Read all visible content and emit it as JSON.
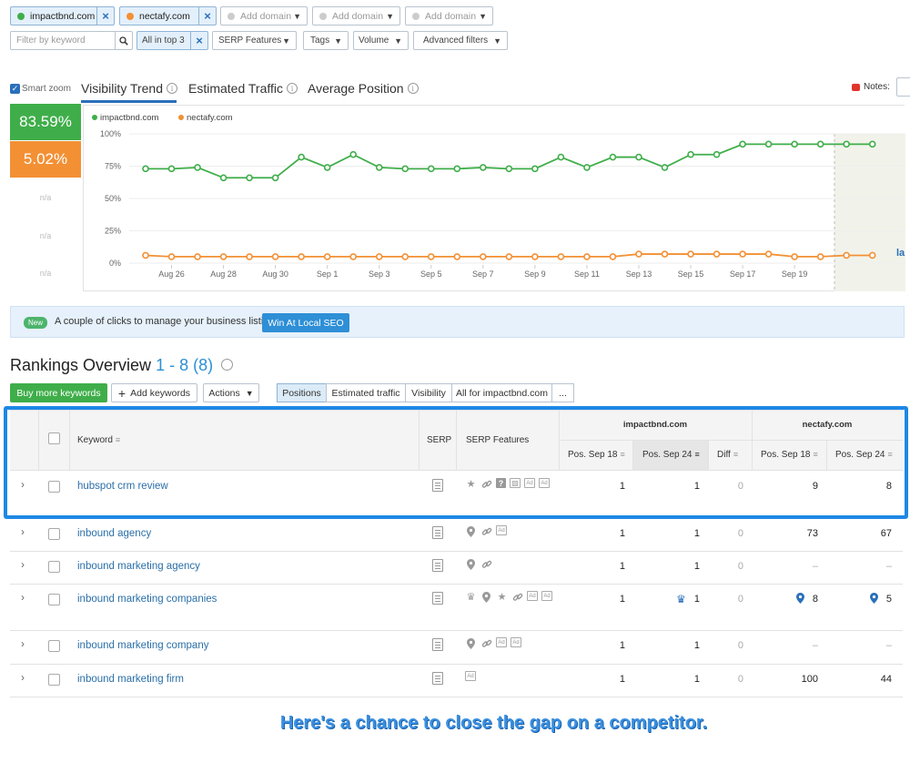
{
  "domains": [
    {
      "name": "impactbnd.com",
      "color": "#3fae4a"
    },
    {
      "name": "nectafy.com",
      "color": "#f39034"
    }
  ],
  "add_domain_placeholders": [
    "Add domain",
    "Add domain",
    "Add domain"
  ],
  "filters": {
    "keyword_placeholder": "Filter by keyword",
    "all_in_top": "All in top 3",
    "serp_features": "SERP Features",
    "tags": "Tags",
    "volume": "Volume",
    "advanced": "Advanced filters"
  },
  "smart_zoom": "Smart zoom",
  "tabs": [
    "Visibility Trend",
    "Estimated Traffic",
    "Average Position"
  ],
  "notes_label": "Notes:",
  "scores": [
    {
      "value": "83.59%",
      "color": "#3fae4a"
    },
    {
      "value": "5.02%",
      "color": "#f39034"
    },
    {
      "value": "n/a"
    },
    {
      "value": "n/a"
    },
    {
      "value": "n/a"
    }
  ],
  "chart_data": {
    "type": "line",
    "legend": [
      "impactbnd.com",
      "nectafy.com"
    ],
    "y_ticks": [
      "100%",
      "75%",
      "50%",
      "25%",
      "0%"
    ],
    "ylim": [
      0,
      100
    ],
    "x_labels": [
      "Aug 26",
      "Aug 28",
      "Aug 30",
      "Sep 1",
      "Sep 3",
      "Sep 5",
      "Sep 7",
      "Sep 9",
      "Sep 11",
      "Sep 13",
      "Sep 15",
      "Sep 17",
      "Sep 19"
    ],
    "series": [
      {
        "name": "impactbnd.com",
        "color": "#3fae4a",
        "values": [
          73,
          73,
          74,
          66,
          66,
          66,
          82,
          74,
          84,
          74,
          73,
          73,
          73,
          74,
          73,
          73,
          82,
          74,
          82,
          82,
          74,
          84,
          84,
          92,
          92,
          92,
          92,
          92,
          92
        ]
      },
      {
        "name": "nectafy.com",
        "color": "#f39034",
        "values": [
          6,
          5,
          5,
          5,
          5,
          5,
          5,
          5,
          5,
          5,
          5,
          5,
          5,
          5,
          5,
          5,
          5,
          5,
          5,
          7,
          7,
          7,
          7,
          7,
          7,
          5,
          5,
          6,
          6
        ]
      }
    ],
    "partial_label": "la"
  },
  "banner": {
    "badge": "New",
    "text": "A couple of clicks to manage your business listings.",
    "button": "Win At Local SEO"
  },
  "rankings": {
    "title": "Rankings Overview",
    "range": "1 - 8 (8)",
    "buy_button": "Buy more keywords",
    "add_keywords": "Add keywords",
    "actions": "Actions",
    "views": [
      "Positions",
      "Estimated traffic",
      "Visibility",
      "All for impactbnd.com",
      "..."
    ]
  },
  "table": {
    "headers": {
      "keyword": "Keyword",
      "serp": "SERP",
      "serp_features": "SERP Features",
      "domain1": "impactbnd.com",
      "domain2": "nectafy.com",
      "pos_sep18": "Pos. Sep 18",
      "pos_sep24": "Pos. Sep 24",
      "diff": "Diff"
    },
    "rows": [
      {
        "keyword": "hubspot crm review",
        "d1_18": "1",
        "d1_24": "1",
        "diff": "0",
        "d2_18": "9",
        "d2_24": "8",
        "features": [
          "star",
          "link",
          "question",
          "image",
          "box",
          "box"
        ]
      },
      {
        "keyword": "inbound agency",
        "d1_18": "1",
        "d1_24": "1",
        "diff": "0",
        "d2_18": "73",
        "d2_24": "67",
        "features": [
          "pin",
          "link",
          "box"
        ]
      },
      {
        "keyword": "inbound marketing agency",
        "d1_18": "1",
        "d1_24": "1",
        "diff": "0",
        "d2_18": "–",
        "d2_24": "–",
        "features": [
          "pin",
          "link"
        ]
      },
      {
        "keyword": "inbound marketing companies",
        "d1_18": "1",
        "d1_24": "1",
        "diff": "0",
        "d2_18": "8",
        "d2_24": "5",
        "features": [
          "crown",
          "pin",
          "star",
          "link",
          "box",
          "box"
        ]
      },
      {
        "keyword": "inbound marketing company",
        "d1_18": "1",
        "d1_24": "1",
        "diff": "0",
        "d2_18": "–",
        "d2_24": "–",
        "features": [
          "pin",
          "link",
          "box",
          "box"
        ]
      },
      {
        "keyword": "inbound marketing firm",
        "d1_18": "1",
        "d1_24": "1",
        "diff": "0",
        "d2_18": "100",
        "d2_24": "44",
        "features": [
          "box"
        ]
      }
    ]
  },
  "caption": "Here's a chance to close the gap on a competitor."
}
